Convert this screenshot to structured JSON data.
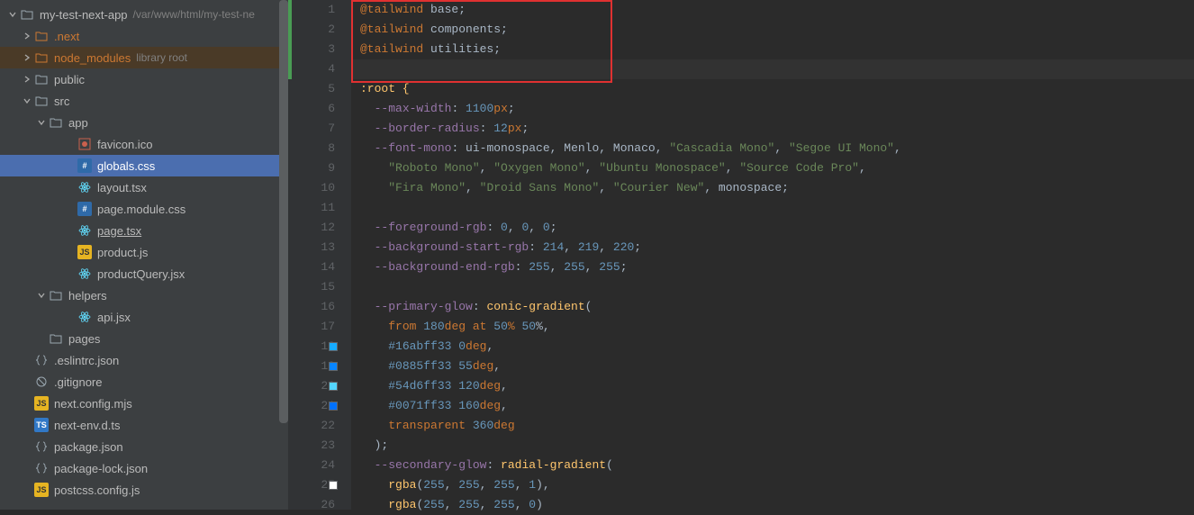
{
  "project": {
    "root_name": "my-test-next-app",
    "root_path": "/var/www/html/my-test-ne",
    "library_hint": "library root"
  },
  "tree": {
    "next": ".next",
    "node_modules": "node_modules",
    "public": "public",
    "src": "src",
    "app": "app",
    "favicon": "favicon.ico",
    "globals": "globals.css",
    "layout": "layout.tsx",
    "page_module": "page.module.css",
    "page_tsx": "page.tsx",
    "product_js": "product.js",
    "product_query": "productQuery.jsx",
    "helpers": "helpers",
    "api_jsx": "api.jsx",
    "pages": "pages",
    "eslintrc": ".eslintrc.json",
    "gitignore": ".gitignore",
    "next_config": "next.config.mjs",
    "next_env": "next-env.d.ts",
    "package_json": "package.json",
    "package_lock": "package-lock.json",
    "postcss": "postcss.config.js"
  },
  "gutter": {
    "lines": [
      "1",
      "2",
      "3",
      "4",
      "5",
      "6",
      "7",
      "8",
      "9",
      "10",
      "11",
      "12",
      "13",
      "14",
      "15",
      "16",
      "17",
      "18",
      "19",
      "20",
      "21",
      "22",
      "23",
      "24",
      "25",
      "26"
    ],
    "swatches": [
      {
        "line": 18,
        "color": "#16abff"
      },
      {
        "line": 19,
        "color": "#0885ff"
      },
      {
        "line": 20,
        "color": "#54d6ff"
      },
      {
        "line": 21,
        "color": "#0071ff"
      },
      {
        "line": 25,
        "color": "#ffffff"
      }
    ]
  },
  "code": {
    "l1_a": "@tailwind",
    "l1_b": " base;",
    "l2_a": "@tailwind",
    "l2_b": " components;",
    "l3_a": "@tailwind",
    "l3_b": " utilities;",
    "l5": ":root {",
    "l6_a": "--max-width",
    "l6_b": ": ",
    "l6_c": "1100",
    "l6_d": "px",
    "l6_e": ";",
    "l7_a": "--border-radius",
    "l7_b": ": ",
    "l7_c": "12",
    "l7_d": "px",
    "l7_e": ";",
    "l8_a": "--font-mono",
    "l8_b": ": ",
    "l8_c": "ui-monospace",
    "l8_d": ", ",
    "l8_e": "Menlo",
    "l8_f": ", ",
    "l8_g": "Monaco",
    "l8_h": ", ",
    "l8_i": "\"Cascadia Mono\"",
    "l8_j": ", ",
    "l8_k": "\"Segoe UI Mono\"",
    "l8_l": ",",
    "l9_a": "\"Roboto Mono\"",
    "l9_b": ", ",
    "l9_c": "\"Oxygen Mono\"",
    "l9_d": ", ",
    "l9_e": "\"Ubuntu Monospace\"",
    "l9_f": ", ",
    "l9_g": "\"Source Code Pro\"",
    "l9_h": ",",
    "l10_a": "\"Fira Mono\"",
    "l10_b": ", ",
    "l10_c": "\"Droid Sans Mono\"",
    "l10_d": ", ",
    "l10_e": "\"Courier New\"",
    "l10_f": ", ",
    "l10_g": "monospace",
    "l10_h": ";",
    "l12_a": "--foreground-rgb",
    "l12_b": ": ",
    "l12_c": "0",
    "l12_d": ", ",
    "l12_e": "0",
    "l12_f": ", ",
    "l12_g": "0",
    "l12_h": ";",
    "l13_a": "--background-start-rgb",
    "l13_b": ": ",
    "l13_c": "214",
    "l13_d": ", ",
    "l13_e": "219",
    "l13_f": ", ",
    "l13_g": "220",
    "l13_h": ";",
    "l14_a": "--background-end-rgb",
    "l14_b": ": ",
    "l14_c": "255",
    "l14_d": ", ",
    "l14_e": "255",
    "l14_f": ", ",
    "l14_g": "255",
    "l14_h": ";",
    "l16_a": "--primary-glow",
    "l16_b": ": ",
    "l16_c": "conic-gradient",
    "l16_d": "(",
    "l17_a": "from ",
    "l17_b": "180",
    "l17_c": "deg",
    "l17_d": " at ",
    "l17_e": "50",
    "l17_f": "% ",
    "l17_g": "50",
    "l17_h": "%,",
    "l18_a": "#16abff33 ",
    "l18_b": "0",
    "l18_c": "deg",
    "l18_d": ",",
    "l19_a": "#0885ff33 ",
    "l19_b": "55",
    "l19_c": "deg",
    "l19_d": ",",
    "l20_a": "#54d6ff33 ",
    "l20_b": "120",
    "l20_c": "deg",
    "l20_d": ",",
    "l21_a": "#0071ff33 ",
    "l21_b": "160",
    "l21_c": "deg",
    "l21_d": ",",
    "l22_a": "transparent ",
    "l22_b": "360",
    "l22_c": "deg",
    "l23": ");",
    "l24_a": "--secondary-glow",
    "l24_b": ": ",
    "l24_c": "radial-gradient",
    "l24_d": "(",
    "l25_a": "rgba",
    "l25_b": "(",
    "l25_c": "255",
    "l25_d": ", ",
    "l25_e": "255",
    "l25_f": ", ",
    "l25_g": "255",
    "l25_h": ", ",
    "l25_i": "1",
    "l25_j": "),",
    "l26_a": "rgba",
    "l26_b": "(",
    "l26_c": "255",
    "l26_d": ", ",
    "l26_e": "255",
    "l26_f": ", ",
    "l26_g": "255",
    "l26_h": ", ",
    "l26_i": "0",
    "l26_j": ")"
  }
}
